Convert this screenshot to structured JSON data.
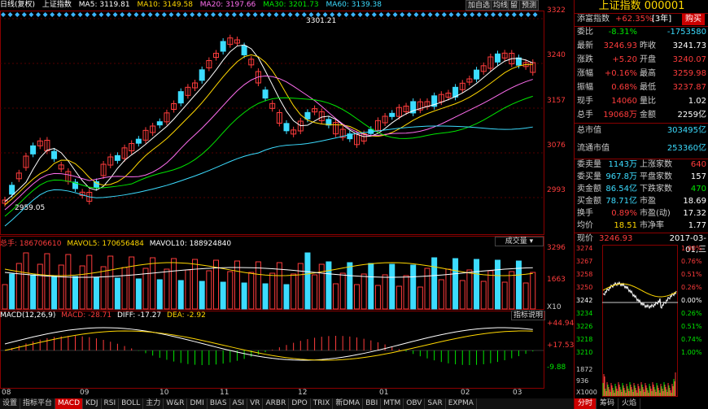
{
  "top": {
    "mode": "日线(复权)",
    "name": "上证指数",
    "ma5": "MA5: 3119.81",
    "ma10": "MA10: 3149.58",
    "ma20": "MA20: 3197.66",
    "ma30": "MA30: 3201.73",
    "ma60": "MA60: 3139.38",
    "buttons": [
      "加自选",
      "均线",
      "留",
      "预测"
    ]
  },
  "main_chart": {
    "y_labels": [
      "3322",
      "3240",
      "3157",
      "3076",
      "2993"
    ],
    "high_label": "3301.21",
    "low_label": "2959.05"
  },
  "volume": {
    "label_total": "总手: 186706610",
    "label_mavol5": "MAVOL5: 170656484",
    "label_mavol10": "MAVOL10: 188924840",
    "dropdown": "成交量",
    "y_labels": [
      "3296",
      "1663"
    ],
    "unit": "X10"
  },
  "macd": {
    "title": "MACD(12,26,9)",
    "macd": "MACD: -28.71",
    "diff": "DIFF: -17.27",
    "dea": "DEA: -2.92",
    "help": "指标说明",
    "y_labels": [
      "+44.94",
      "+17.53",
      "-9.88"
    ]
  },
  "x_labels": [
    "08",
    "09",
    "10",
    "11",
    "12",
    "01",
    "02",
    "03"
  ],
  "bottom_tabs": [
    "设置",
    "指标平台",
    "MACD",
    "KDJ",
    "RSI",
    "BOLL",
    "主力",
    "W&R",
    "DMI",
    "BIAS",
    "ASI",
    "VR",
    "ARBR",
    "DPO",
    "TRIX",
    "新DMA",
    "BBI",
    "MTM",
    "OBV",
    "SAR",
    "EXPMA"
  ],
  "right": {
    "title": "上证指数 000001",
    "wealth_label": "添富指数",
    "wealth_value": "+62.35%",
    "wealth_period": "[3年]",
    "buy": "购买",
    "rows": [
      {
        "k": "委比",
        "v1": "-8.31%",
        "k2": "",
        "v2": "-1753580"
      },
      {
        "k": "最新",
        "v1": "3246.93",
        "k2": "昨收",
        "v2": "3241.73"
      },
      {
        "k": "涨跌",
        "v1": "+5.20",
        "k2": "开盘",
        "v2": "3240.07"
      },
      {
        "k": "涨幅",
        "v1": "+0.16%",
        "k2": "最高",
        "v2": "3259.98"
      },
      {
        "k": "振幅",
        "v1": "0.68%",
        "k2": "最低",
        "v2": "3237.87"
      },
      {
        "k": "现手",
        "v1": "14060",
        "k2": "量比",
        "v2": "1.02"
      },
      {
        "k": "总手",
        "v1": "19068万",
        "k2": "金额",
        "v2": "2259亿"
      }
    ],
    "mkt": [
      {
        "k": "总市值",
        "v": "303495亿"
      },
      {
        "k": "流通市值",
        "v": "253360亿"
      }
    ],
    "stats": [
      {
        "k": "委卖量",
        "v1": "1143万",
        "k2": "上涨家数",
        "v2": "640"
      },
      {
        "k": "委买量",
        "v1": "967.8万",
        "k2": "平盘家数",
        "v2": "157"
      },
      {
        "k": "卖金额",
        "v1": "86.54亿",
        "k2": "下跌家数",
        "v2": "470"
      },
      {
        "k": "买金额",
        "v1": "78.71亿",
        "k2": "市盈",
        "v2": "18.69"
      },
      {
        "k": "换手",
        "v1": "0.89%",
        "k2": "市盈(动)",
        "v2": "17.32"
      },
      {
        "k": "均价",
        "v1": "18.51",
        "k2": "市净率",
        "v2": "1.77"
      }
    ],
    "now_label": "现价",
    "now_value": "3246.93",
    "now_date": "2017-03-01,三",
    "mini_y_left": [
      "3274",
      "3267",
      "3258",
      "3250",
      "3242",
      "3234",
      "3226",
      "3218",
      "3210"
    ],
    "mini_y_right": [
      "1.00%",
      "0.76%",
      "0.51%",
      "0.26%",
      "0.00%",
      "0.26%",
      "0.51%",
      "0.74%",
      "1.00%"
    ],
    "mini_vol_labels": [
      "1872",
      "936",
      "X1000"
    ],
    "tabs": [
      "分时",
      "筹码",
      "火焰"
    ]
  },
  "colors": {
    "up": "#ff3c3c",
    "down": "#3cdcff",
    "ma5": "#ffffff",
    "ma10": "#ffd700",
    "ma20": "#ff6ef0",
    "ma30": "#00e600",
    "ma60": "#3cdcff"
  }
}
